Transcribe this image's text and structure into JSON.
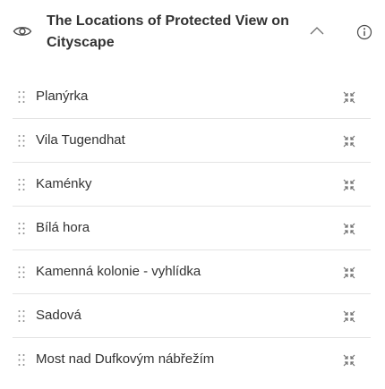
{
  "panel": {
    "title": "The Locations of Protected View on Cityscape",
    "icons": {
      "visibility": "eye-icon",
      "collapse": "chevron-up-icon",
      "info": "info-icon",
      "drag": "drag-handle-icon",
      "zoom": "zoom-to-icon"
    },
    "colors": {
      "text": "#323232",
      "icon": "#6e6e6e",
      "divider": "#e4e4e4"
    }
  },
  "locations": [
    {
      "label": "Planýrka"
    },
    {
      "label": "Vila Tugendhat"
    },
    {
      "label": "Kaménky"
    },
    {
      "label": "Bílá hora"
    },
    {
      "label": "Kamenná kolonie - vyhlídka"
    },
    {
      "label": "Sadová"
    },
    {
      "label": "Most nad Dufkovým nábřežím"
    }
  ]
}
